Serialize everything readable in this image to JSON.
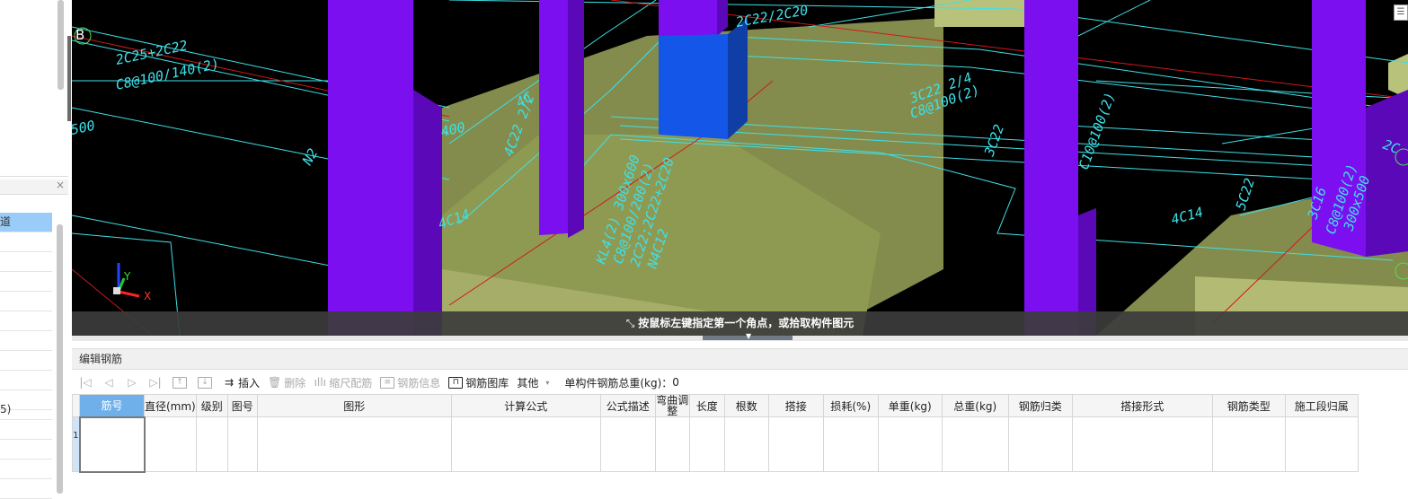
{
  "viewport": {
    "axis_label": "B",
    "axis_x": "X",
    "axis_y": "Y",
    "status_text": "按鼠标左键指定第一个角点，或拾取构件图元",
    "rebar_labels": {
      "beam1_top": "2C25+2C22",
      "beam1_stirrup": "C8@100/140(2)",
      "dim_500": "500",
      "dim_400": "400",
      "label_4c": "4C",
      "label_4c22": "4C22 2/2",
      "label_n2": "N2",
      "label_4c14_left": "4C14",
      "label_2c22": "2C22/2C20",
      "label_3c22": "3C22 2/4",
      "label_c8_100": "C8@100(2)",
      "label_3c22b": "3C22",
      "label_kl": "KL4(2) 300x600",
      "label_kl2": "C8@100/200(2)",
      "label_kl3": "2C22;2C22+2C20",
      "label_kl4": "N4C12",
      "label_4c14": "4C14",
      "label_5c22": "5C22",
      "label_right1": "3C16",
      "label_right2": "C8@100(2)",
      "label_right3": "300x500",
      "label_c100": "C10@100(2)",
      "label_2c": "2C"
    }
  },
  "left_panel": {
    "selected_item": "道",
    "item_5": "5)"
  },
  "editor": {
    "title": "编辑钢筋",
    "toolbar": {
      "insert": "插入",
      "delete": "删除",
      "scale_rebar": "缩尺配筋",
      "rebar_info": "钢筋信息",
      "rebar_library": "钢筋图库",
      "other": "其他",
      "total_weight_label": "单构件钢筋总重(kg)：",
      "total_weight_value": "0"
    },
    "columns": [
      "筋号",
      "直径(mm)",
      "级别",
      "图号",
      "图形",
      "计算公式",
      "公式描述",
      "弯曲调整",
      "长度",
      "根数",
      "搭接",
      "损耗(%)",
      "单重(kg)",
      "总重(kg)",
      "钢筋归类",
      "搭接形式",
      "钢筋类型",
      "施工段归属"
    ],
    "row_number": "1"
  }
}
